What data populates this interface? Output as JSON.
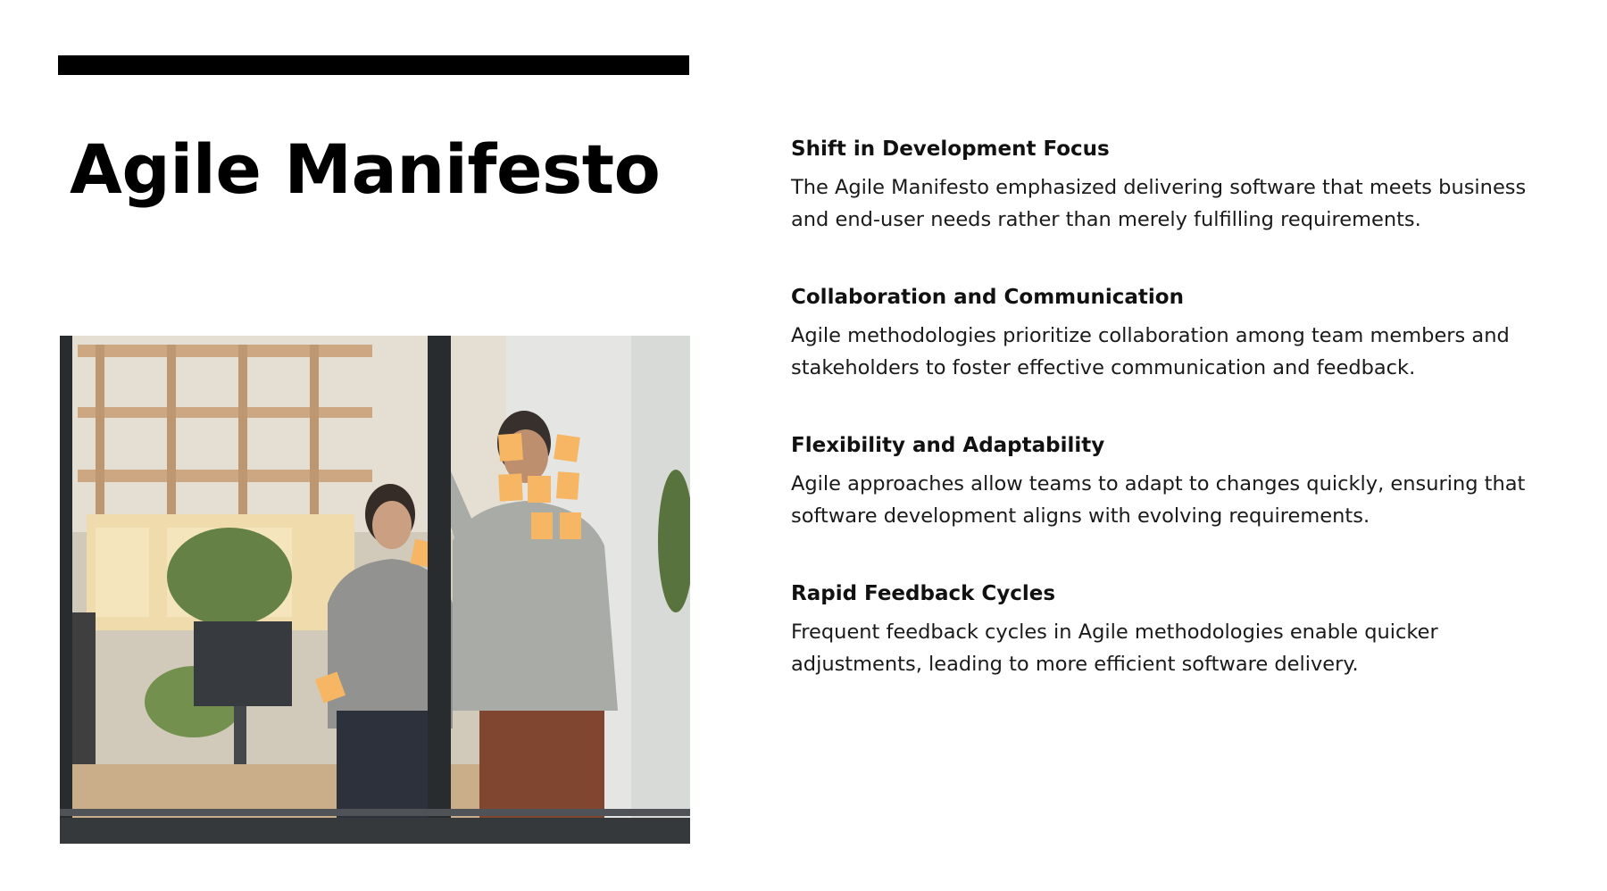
{
  "slide": {
    "title": "Agile Manifesto"
  },
  "photo": {
    "description_icon": "office-team-sticky-notes-photo"
  },
  "points": [
    {
      "heading": "Shift in Development Focus",
      "body": "The Agile Manifesto emphasized delivering software that meets business and end-user needs rather than merely fulfilling requirements."
    },
    {
      "heading": "Collaboration and Communication",
      "body": "Agile methodologies prioritize collaboration among team members and stakeholders to foster effective communication and feedback."
    },
    {
      "heading": "Flexibility and Adaptability",
      "body": "Agile approaches allow teams to adapt to changes quickly, ensuring that software development aligns with evolving requirements."
    },
    {
      "heading": "Rapid Feedback Cycles",
      "body": "Frequent feedback cycles in Agile methodologies enable quicker adjustments, leading to more efficient software delivery."
    }
  ],
  "colors": {
    "accent_bar": "#000000",
    "sticky_note": "#f6b25a",
    "text": "#111111"
  }
}
